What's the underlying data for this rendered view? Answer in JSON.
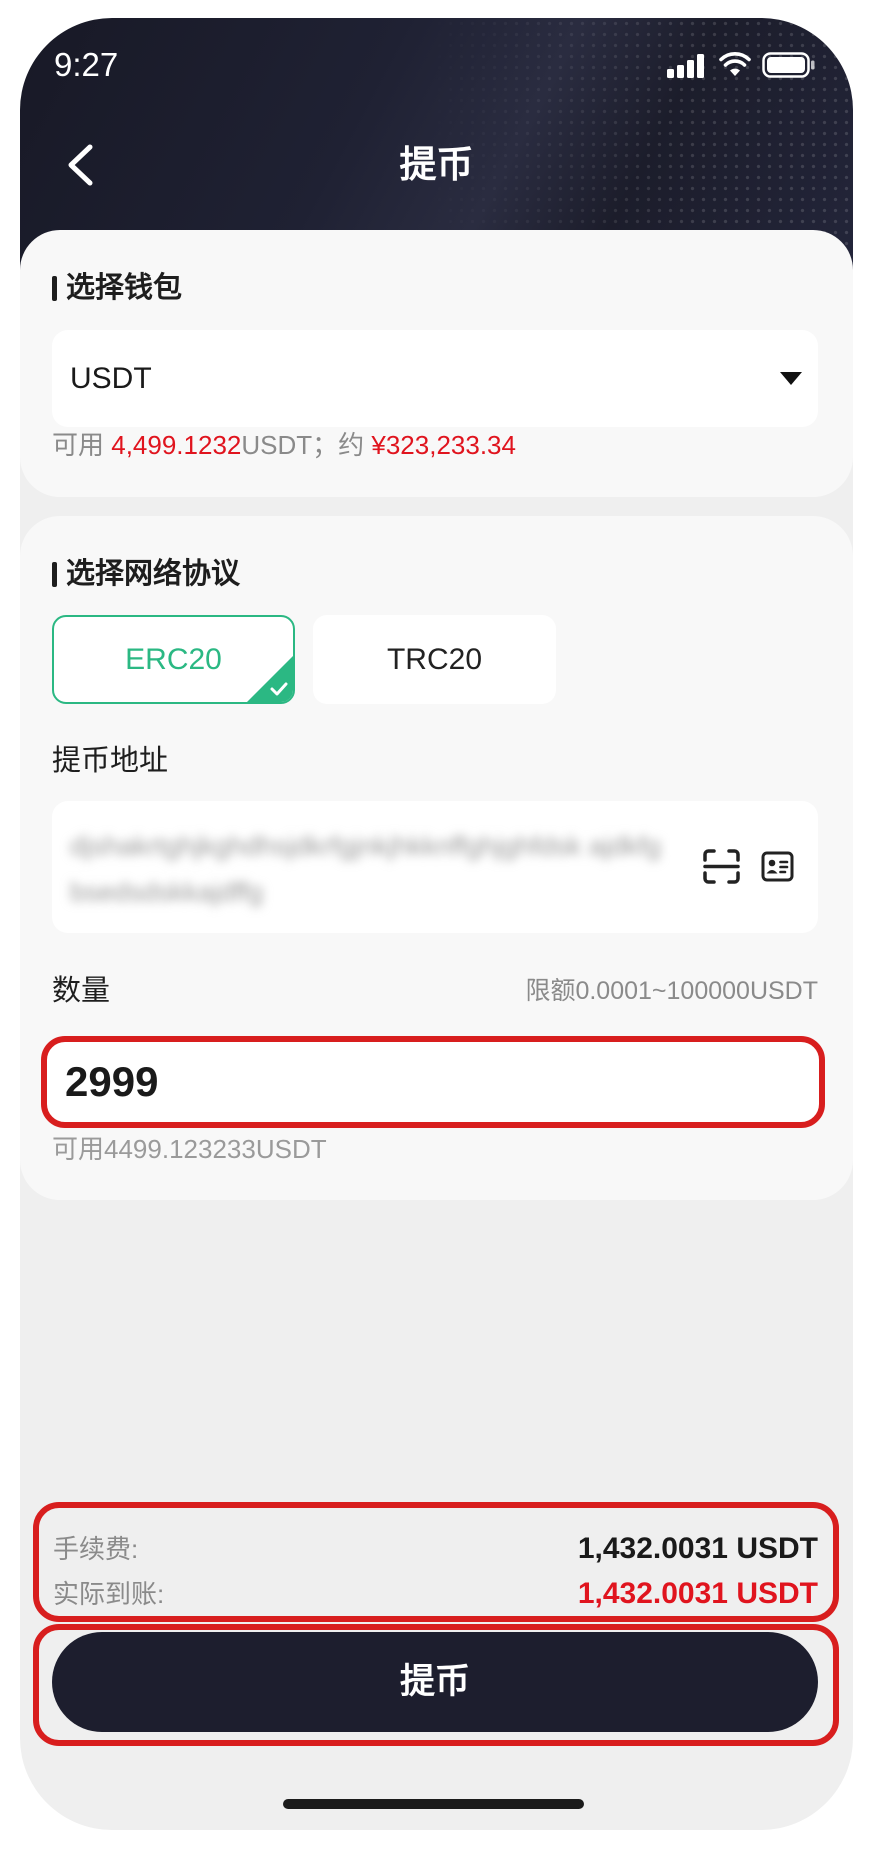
{
  "status_bar": {
    "time": "9:27"
  },
  "header": {
    "title": "提币"
  },
  "wallet_section": {
    "title": "选择钱包",
    "selected_coin": "USDT",
    "available_prefix": "可用 ",
    "available_amount": "4,499.1232",
    "available_unit": "USDT；约 ",
    "available_fiat": "¥323,233.34"
  },
  "network_section": {
    "title": "选择网络协议",
    "options": [
      {
        "label": "ERC20",
        "selected": true
      },
      {
        "label": "TRC20",
        "selected": false
      }
    ]
  },
  "address": {
    "label": "提币地址",
    "value": "djshakrtghjkghdhsjdkrfgjnkjhkknffghjghfdsk ajdkfgbsedsdskkajdffg"
  },
  "amount": {
    "label": "数量",
    "limit": "限额0.0001~100000USDT",
    "value": "2999",
    "available": "可用4499.123233USDT"
  },
  "summary": {
    "fee_label": "手续费:",
    "fee_value": "1,432.0031 USDT",
    "received_label": "实际到账:",
    "received_value": "1,432.0031 USDT"
  },
  "submit": {
    "label": "提币"
  },
  "icons": {
    "back": "chevron-left-icon",
    "dropdown": "caret-down-icon",
    "scan": "scan-icon",
    "address_book": "address-book-icon",
    "selected_check": "check-icon",
    "signal": "signal-icon",
    "wifi": "wifi-icon",
    "battery": "battery-icon"
  },
  "colors": {
    "header_bg": "#1d1e2e",
    "accent_green": "#2bb883",
    "highlight_red": "#e0141e",
    "annotation_red": "#d81e1e",
    "page_bg": "#efefef"
  }
}
